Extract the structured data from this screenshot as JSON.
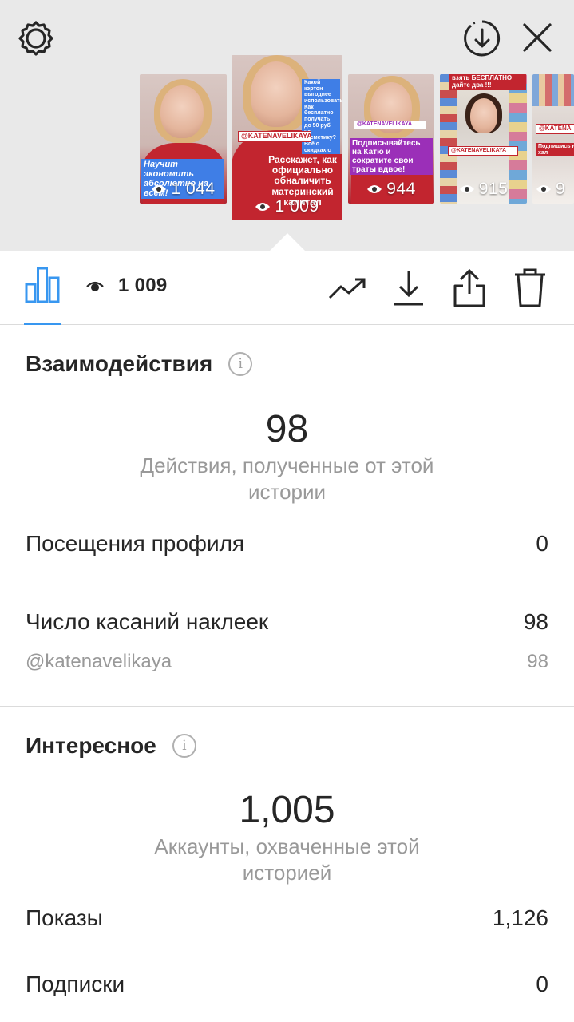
{
  "stories": [
    {
      "caption": "Научит экономить абсолютно на всём!",
      "views": "1 044"
    },
    {
      "caption": "Расскажет, как официально обналичить материнский капитал",
      "views": "1 009",
      "handle": "@KATENAVELIKAYA",
      "top_text": "Какой кэртон выгоднее использовать? Как бесплатно получать до 50 руб на косметику? Всё о скидках с купонами"
    },
    {
      "caption": "Подписывайтесь на Катю и сократите свои траты вдвое!",
      "views": "944",
      "handle": "@KATENAVELIKAYA"
    },
    {
      "caption": "взять БЕСПЛАТНО дайте два !!!",
      "views": "915",
      "handle": "@KATENAVELIKAYA"
    },
    {
      "caption": "Подпишись на хал",
      "views": "9",
      "handle": "@KATENA"
    }
  ],
  "toolbar": {
    "views": "1 009"
  },
  "interactions": {
    "title": "Взаимодействия",
    "total": "98",
    "total_label": "Действия, полученные от этой истории",
    "rows": [
      {
        "label": "Посещения профиля",
        "value": "0"
      },
      {
        "label": "Число касаний наклеек",
        "value": "98"
      },
      {
        "label": "@katenavelikaya",
        "value": "98"
      }
    ]
  },
  "discovery": {
    "title": "Интересное",
    "total": "1,005",
    "total_label": "Аккаунты, охваченные этой историей",
    "rows": [
      {
        "label": "Показы",
        "value": "1,126"
      },
      {
        "label": "Подписки",
        "value": "0"
      }
    ]
  },
  "colors": {
    "accent": "#3897f0",
    "text": "#262626",
    "muted": "#999999",
    "divider": "#dbdbdb",
    "top_bg": "#e9e9e9"
  }
}
